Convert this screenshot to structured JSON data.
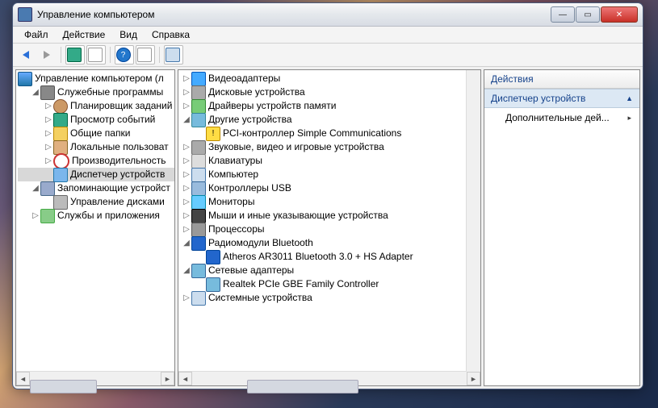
{
  "window": {
    "title": "Управление компьютером"
  },
  "menu": {
    "file": "Файл",
    "action": "Действие",
    "view": "Вид",
    "help": "Справка"
  },
  "left_tree": {
    "root": "Управление компьютером (л",
    "system_tools": "Служебные программы",
    "scheduler": "Планировщик заданий",
    "event_viewer": "Просмотр событий",
    "shared_folders": "Общие папки",
    "local_users": "Локальные пользоват",
    "performance": "Производительность",
    "device_manager": "Диспетчер устройств",
    "storage": "Запоминающие устройст",
    "disk_mgmt": "Управление дисками",
    "services": "Службы и приложения"
  },
  "mid_tree": {
    "video": "Видеоадаптеры",
    "disks": "Дисковые устройства",
    "mem_drivers": "Драйверы устройств памяти",
    "other": "Другие устройства",
    "pci_simple": "PCI-контроллер Simple Communications",
    "sound": "Звуковые, видео и игровые устройства",
    "keyboards": "Клавиатуры",
    "computer": "Компьютер",
    "usb": "Контроллеры USB",
    "monitors": "Мониторы",
    "mice": "Мыши и иные указывающие устройства",
    "cpu": "Процессоры",
    "bt": "Радиомодули Bluetooth",
    "bt_dev": "Atheros AR3011 Bluetooth 3.0 + HS Adapter",
    "net": "Сетевые адаптеры",
    "net_dev": "Realtek PCIe GBE Family Controller",
    "system": "Системные устройства"
  },
  "actions": {
    "header": "Действия",
    "section": "Диспетчер устройств",
    "more": "Дополнительные дей..."
  }
}
